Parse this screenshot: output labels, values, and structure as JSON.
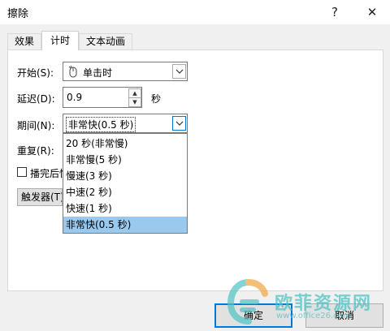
{
  "window": {
    "title": "擦除",
    "help": "?",
    "close": "✕"
  },
  "tabs": [
    {
      "label": "效果"
    },
    {
      "label": "计时"
    },
    {
      "label": "文本动画"
    }
  ],
  "timing": {
    "start_label": "开始(S):",
    "start_value": "单击时",
    "delay_label": "延迟(D):",
    "delay_value": "0.9",
    "delay_unit": "秒",
    "duration_label": "期间(N):",
    "duration_value": "非常快(0.5 秒)",
    "repeat_label": "重复(R):",
    "rewind_label": "播完后快",
    "trigger_label": "触发器(T)"
  },
  "duration_options": [
    "20 秒(非常慢)",
    "非常慢(5 秒)",
    "慢速(3 秒)",
    "中速(2 秒)",
    "快速(1 秒)",
    "非常快(0.5 秒)"
  ],
  "buttons": {
    "ok": "确定",
    "cancel": "取消"
  },
  "watermark": {
    "text": "欧菲资源网",
    "url": "www.office26.com"
  },
  "colors": {
    "selection": "#99c9ef",
    "default_button_border": "#0078d7",
    "watermark": "#4ec3c4"
  }
}
